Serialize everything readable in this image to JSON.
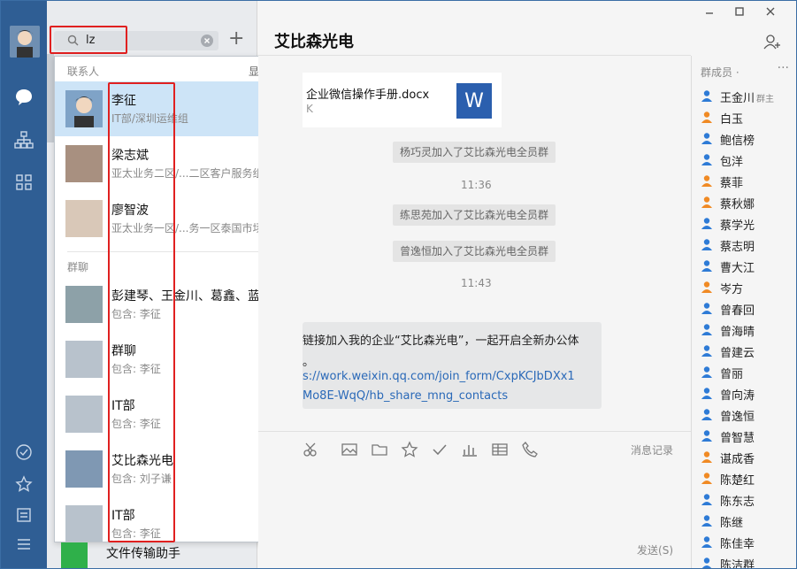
{
  "search": {
    "value": "lz"
  },
  "dropdown": {
    "contacts_header": "联系人",
    "show_more": "显示更多",
    "contacts": [
      {
        "name": "李征",
        "sub": "IT部/深圳运维组"
      },
      {
        "name": "梁志斌",
        "sub": "亚太业务二区/...二区客户服务组"
      },
      {
        "name": "廖智波",
        "sub": "亚太业务一区/...务一区泰国市场"
      }
    ],
    "groups_header": "群聊",
    "groups": [
      {
        "name": "彭建琴、王金川、葛鑫、蓝光明",
        "sub": "包含: 李征"
      },
      {
        "name": "群聊",
        "sub": "包含: 李征"
      },
      {
        "name": "IT部",
        "sub": "包含: 李征"
      },
      {
        "name": "艾比森光电",
        "sub": "包含: 刘子谦"
      },
      {
        "name": "IT部",
        "sub": "包含: 李征"
      }
    ]
  },
  "chat": {
    "title": "艾比森光电",
    "file": {
      "name": "企业微信操作手册.docx",
      "size": "K",
      "icon_letter": "W"
    },
    "sys1": "杨巧灵加入了艾比森光电全员群",
    "time1": "11:36",
    "sys2": "练思苑加入了艾比森光电全员群",
    "sys3": "曾逸恒加入了艾比森光电全员群",
    "time2": "11:43",
    "bubble": {
      "line1": "链接加入我的企业“艾比森光电”，一起开启全新办公体",
      "line2": "。",
      "link1": "s://work.weixin.qq.com/join_form/CxpKCJbDXx1",
      "link2": "Mo8E-WqQ/hb_share_mng_contacts"
    },
    "history_label": "消息记录",
    "send_label": "发送(S)",
    "filechat_name": "文件传输助手"
  },
  "members": {
    "header": "群成员 ·",
    "more": "···",
    "owner_tag": "群主",
    "list": [
      "王金川",
      "白玉",
      "鲍信榜",
      "包洋",
      "蔡菲",
      "蔡秋娜",
      "蔡学光",
      "蔡志明",
      "曹大江",
      "岑方",
      "曾春回",
      "曾海晴",
      "曾建云",
      "曾丽",
      "曾向涛",
      "曾逸恒",
      "曾智慧",
      "谌成香",
      "陈楚红",
      "陈东志",
      "陈继",
      "陈佳幸",
      "陈洁群"
    ],
    "colors": {
      "blue": "#2e7bd6",
      "orange": "#f08a24"
    }
  },
  "colors": {
    "rail": "#2f5e94",
    "highlight": "#cde4f7",
    "accent_red": "#e02020"
  }
}
